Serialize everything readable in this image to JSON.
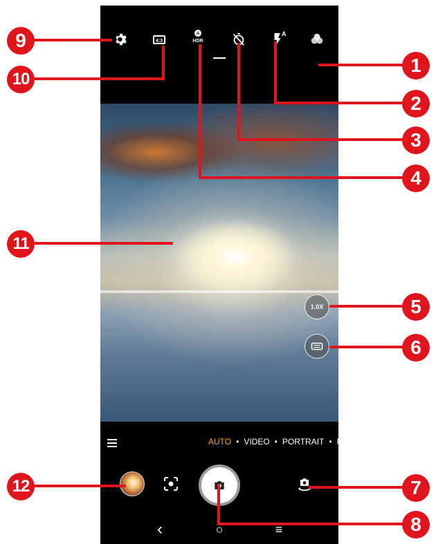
{
  "top_bar": {
    "settings_icon": "gear-icon",
    "aspect_ratio": "4:3",
    "hdr": {
      "icon": "hdr-auto-icon",
      "label": "HDR"
    },
    "timer_icon": "timer-off-icon",
    "flash": {
      "icon": "flash-icon",
      "mode": "A"
    },
    "filter_icon": "filter-icon"
  },
  "zoom": {
    "label": "1.0X"
  },
  "panorama_icon": "panorama-icon",
  "modes": {
    "items": [
      "AUTO",
      "VIDEO",
      "PORTRAIT",
      "PA"
    ],
    "active": "AUTO",
    "active_color": "#f5a623"
  },
  "bottom_bar": {
    "gallery_thumbnail": "thumbnail",
    "lens_icon": "google-lens-icon",
    "shutter_icon": "camera-icon",
    "switch_icon": "switch-camera-icon"
  },
  "nav": {
    "back": "‹",
    "home": "○",
    "recents": "≡"
  },
  "callouts": {
    "color": "#e0141c",
    "labels": [
      "1",
      "2",
      "3",
      "4",
      "5",
      "6",
      "7",
      "8",
      "9",
      "10",
      "11",
      "12"
    ]
  }
}
